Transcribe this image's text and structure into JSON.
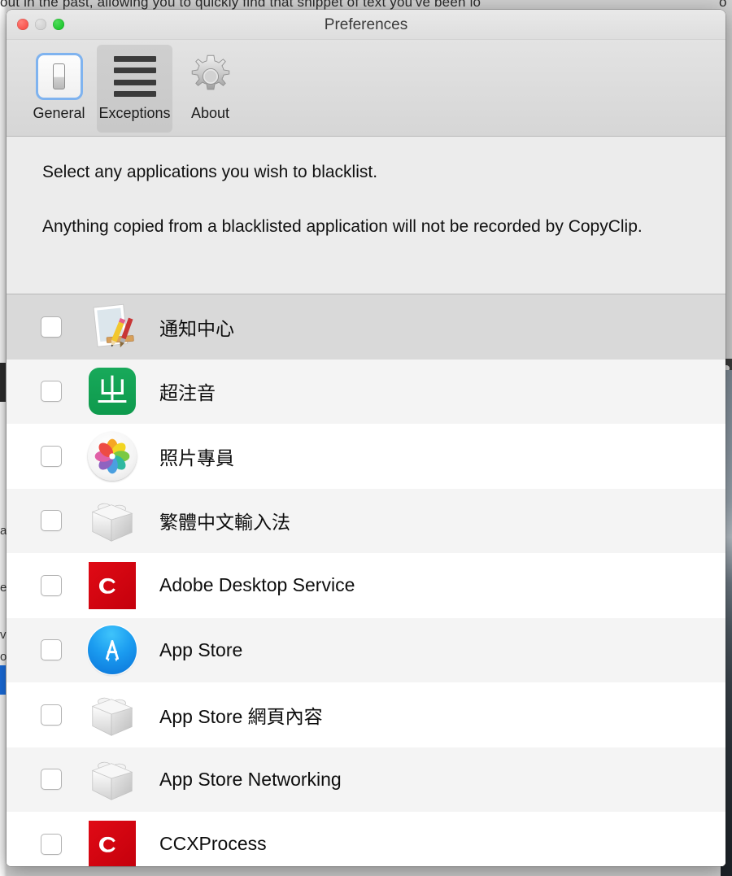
{
  "background": {
    "top_text": "out in the past, allowing you to quickly find that snippet of text you've been lo",
    "top_text_right": "o",
    "left_fragments": [
      "a",
      "e",
      "v",
      "o"
    ]
  },
  "window": {
    "title": "Preferences",
    "traffic_lights": [
      {
        "name": "close",
        "label": "Close",
        "color": "#f75049"
      },
      {
        "name": "minimize",
        "label": "Minimize",
        "color": "#cfcfcf"
      },
      {
        "name": "zoom",
        "label": "Zoom",
        "color": "#18c328"
      }
    ]
  },
  "toolbar": {
    "items": [
      {
        "label": "General",
        "icon": "toggle-switch-icon",
        "selected": false
      },
      {
        "label": "Exceptions",
        "icon": "list-bars-icon",
        "selected": true
      },
      {
        "label": "About",
        "icon": "gear-icon",
        "selected": false
      }
    ]
  },
  "description": {
    "line1": "Select any applications you wish to blacklist.",
    "line2": "Anything copied from a blacklisted application will not be recorded by CopyClip."
  },
  "app_list": {
    "rows": [
      {
        "label": "通知中心",
        "icon": "textedit-icon",
        "checked": false,
        "tint": "dark"
      },
      {
        "label": "超注音",
        "icon": "ime-green-icon",
        "checked": false,
        "tint": "light",
        "glyph": "ㄓ"
      },
      {
        "label": "照片專員",
        "icon": "photos-icon",
        "checked": false,
        "tint": "white"
      },
      {
        "label": "繁體中文輸入法",
        "icon": "bundle-icon",
        "checked": false,
        "tint": "light"
      },
      {
        "label": "Adobe Desktop Service",
        "icon": "adobe-cc-icon",
        "checked": false,
        "tint": "white"
      },
      {
        "label": "App Store",
        "icon": "appstore-icon",
        "checked": false,
        "tint": "light"
      },
      {
        "label": "App Store 網頁內容",
        "icon": "bundle-icon",
        "checked": false,
        "tint": "white"
      },
      {
        "label": "App Store Networking",
        "icon": "bundle-icon",
        "checked": false,
        "tint": "light"
      },
      {
        "label": "CCXProcess",
        "icon": "adobe-cc-icon",
        "checked": false,
        "tint": "white"
      }
    ]
  },
  "colors": {
    "accent_blue": "#7fb3ef",
    "window_bg": "#ececec",
    "row_dark": "#d9d9d9",
    "row_light": "#f4f4f4",
    "row_white": "#ffffff",
    "adobe_red": "#c4000c",
    "ime_green": "#0e9a4d",
    "appstore_blue": "#1b9cf0"
  }
}
